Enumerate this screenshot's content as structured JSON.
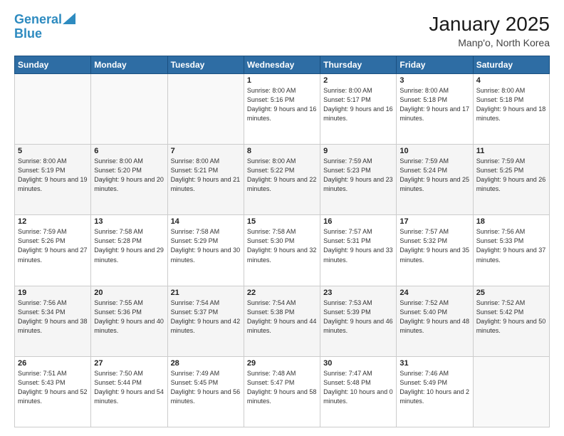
{
  "logo": {
    "line1": "General",
    "line2": "Blue"
  },
  "title": "January 2025",
  "location": "Manp'o, North Korea",
  "weekdays": [
    "Sunday",
    "Monday",
    "Tuesday",
    "Wednesday",
    "Thursday",
    "Friday",
    "Saturday"
  ],
  "weeks": [
    [
      {
        "day": "",
        "sunrise": "",
        "sunset": "",
        "daylight": ""
      },
      {
        "day": "",
        "sunrise": "",
        "sunset": "",
        "daylight": ""
      },
      {
        "day": "",
        "sunrise": "",
        "sunset": "",
        "daylight": ""
      },
      {
        "day": "1",
        "sunrise": "Sunrise: 8:00 AM",
        "sunset": "Sunset: 5:16 PM",
        "daylight": "Daylight: 9 hours and 16 minutes."
      },
      {
        "day": "2",
        "sunrise": "Sunrise: 8:00 AM",
        "sunset": "Sunset: 5:17 PM",
        "daylight": "Daylight: 9 hours and 16 minutes."
      },
      {
        "day": "3",
        "sunrise": "Sunrise: 8:00 AM",
        "sunset": "Sunset: 5:18 PM",
        "daylight": "Daylight: 9 hours and 17 minutes."
      },
      {
        "day": "4",
        "sunrise": "Sunrise: 8:00 AM",
        "sunset": "Sunset: 5:18 PM",
        "daylight": "Daylight: 9 hours and 18 minutes."
      }
    ],
    [
      {
        "day": "5",
        "sunrise": "Sunrise: 8:00 AM",
        "sunset": "Sunset: 5:19 PM",
        "daylight": "Daylight: 9 hours and 19 minutes."
      },
      {
        "day": "6",
        "sunrise": "Sunrise: 8:00 AM",
        "sunset": "Sunset: 5:20 PM",
        "daylight": "Daylight: 9 hours and 20 minutes."
      },
      {
        "day": "7",
        "sunrise": "Sunrise: 8:00 AM",
        "sunset": "Sunset: 5:21 PM",
        "daylight": "Daylight: 9 hours and 21 minutes."
      },
      {
        "day": "8",
        "sunrise": "Sunrise: 8:00 AM",
        "sunset": "Sunset: 5:22 PM",
        "daylight": "Daylight: 9 hours and 22 minutes."
      },
      {
        "day": "9",
        "sunrise": "Sunrise: 7:59 AM",
        "sunset": "Sunset: 5:23 PM",
        "daylight": "Daylight: 9 hours and 23 minutes."
      },
      {
        "day": "10",
        "sunrise": "Sunrise: 7:59 AM",
        "sunset": "Sunset: 5:24 PM",
        "daylight": "Daylight: 9 hours and 25 minutes."
      },
      {
        "day": "11",
        "sunrise": "Sunrise: 7:59 AM",
        "sunset": "Sunset: 5:25 PM",
        "daylight": "Daylight: 9 hours and 26 minutes."
      }
    ],
    [
      {
        "day": "12",
        "sunrise": "Sunrise: 7:59 AM",
        "sunset": "Sunset: 5:26 PM",
        "daylight": "Daylight: 9 hours and 27 minutes."
      },
      {
        "day": "13",
        "sunrise": "Sunrise: 7:58 AM",
        "sunset": "Sunset: 5:28 PM",
        "daylight": "Daylight: 9 hours and 29 minutes."
      },
      {
        "day": "14",
        "sunrise": "Sunrise: 7:58 AM",
        "sunset": "Sunset: 5:29 PM",
        "daylight": "Daylight: 9 hours and 30 minutes."
      },
      {
        "day": "15",
        "sunrise": "Sunrise: 7:58 AM",
        "sunset": "Sunset: 5:30 PM",
        "daylight": "Daylight: 9 hours and 32 minutes."
      },
      {
        "day": "16",
        "sunrise": "Sunrise: 7:57 AM",
        "sunset": "Sunset: 5:31 PM",
        "daylight": "Daylight: 9 hours and 33 minutes."
      },
      {
        "day": "17",
        "sunrise": "Sunrise: 7:57 AM",
        "sunset": "Sunset: 5:32 PM",
        "daylight": "Daylight: 9 hours and 35 minutes."
      },
      {
        "day": "18",
        "sunrise": "Sunrise: 7:56 AM",
        "sunset": "Sunset: 5:33 PM",
        "daylight": "Daylight: 9 hours and 37 minutes."
      }
    ],
    [
      {
        "day": "19",
        "sunrise": "Sunrise: 7:56 AM",
        "sunset": "Sunset: 5:34 PM",
        "daylight": "Daylight: 9 hours and 38 minutes."
      },
      {
        "day": "20",
        "sunrise": "Sunrise: 7:55 AM",
        "sunset": "Sunset: 5:36 PM",
        "daylight": "Daylight: 9 hours and 40 minutes."
      },
      {
        "day": "21",
        "sunrise": "Sunrise: 7:54 AM",
        "sunset": "Sunset: 5:37 PM",
        "daylight": "Daylight: 9 hours and 42 minutes."
      },
      {
        "day": "22",
        "sunrise": "Sunrise: 7:54 AM",
        "sunset": "Sunset: 5:38 PM",
        "daylight": "Daylight: 9 hours and 44 minutes."
      },
      {
        "day": "23",
        "sunrise": "Sunrise: 7:53 AM",
        "sunset": "Sunset: 5:39 PM",
        "daylight": "Daylight: 9 hours and 46 minutes."
      },
      {
        "day": "24",
        "sunrise": "Sunrise: 7:52 AM",
        "sunset": "Sunset: 5:40 PM",
        "daylight": "Daylight: 9 hours and 48 minutes."
      },
      {
        "day": "25",
        "sunrise": "Sunrise: 7:52 AM",
        "sunset": "Sunset: 5:42 PM",
        "daylight": "Daylight: 9 hours and 50 minutes."
      }
    ],
    [
      {
        "day": "26",
        "sunrise": "Sunrise: 7:51 AM",
        "sunset": "Sunset: 5:43 PM",
        "daylight": "Daylight: 9 hours and 52 minutes."
      },
      {
        "day": "27",
        "sunrise": "Sunrise: 7:50 AM",
        "sunset": "Sunset: 5:44 PM",
        "daylight": "Daylight: 9 hours and 54 minutes."
      },
      {
        "day": "28",
        "sunrise": "Sunrise: 7:49 AM",
        "sunset": "Sunset: 5:45 PM",
        "daylight": "Daylight: 9 hours and 56 minutes."
      },
      {
        "day": "29",
        "sunrise": "Sunrise: 7:48 AM",
        "sunset": "Sunset: 5:47 PM",
        "daylight": "Daylight: 9 hours and 58 minutes."
      },
      {
        "day": "30",
        "sunrise": "Sunrise: 7:47 AM",
        "sunset": "Sunset: 5:48 PM",
        "daylight": "Daylight: 10 hours and 0 minutes."
      },
      {
        "day": "31",
        "sunrise": "Sunrise: 7:46 AM",
        "sunset": "Sunset: 5:49 PM",
        "daylight": "Daylight: 10 hours and 2 minutes."
      },
      {
        "day": "",
        "sunrise": "",
        "sunset": "",
        "daylight": ""
      }
    ]
  ]
}
